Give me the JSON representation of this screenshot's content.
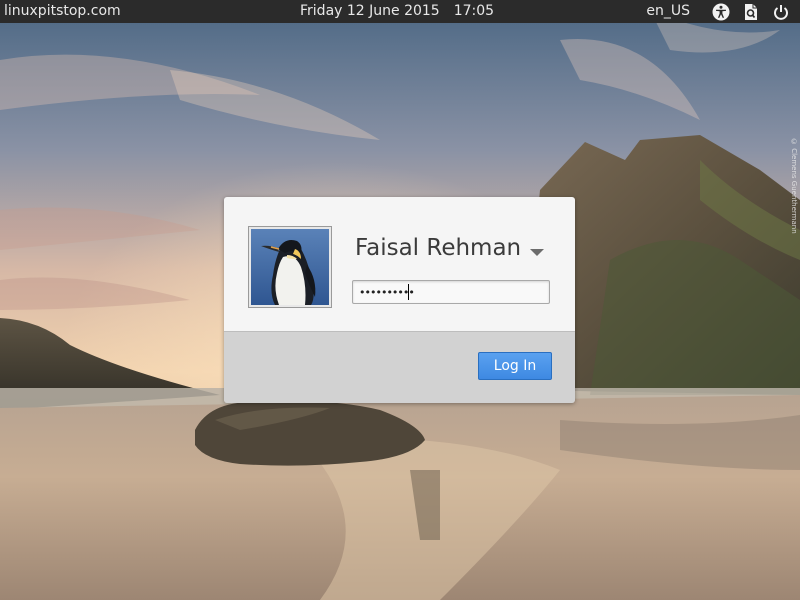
{
  "panel": {
    "hostname": "linuxpitstop.com",
    "date": "Friday 12 June 2015",
    "time": "17:05",
    "language": "en_US",
    "icons": [
      "accessibility-icon",
      "keyboard-layout-icon",
      "power-icon"
    ]
  },
  "photo_credit": "© Clemens Guenthermann",
  "login": {
    "user_name": "Faisal Rehman",
    "avatar": "penguin-avatar",
    "password_value": "••••••••••",
    "login_label": "Log In"
  },
  "colors": {
    "panel_bg": "#2b2b2b",
    "accent": "#3e89e2",
    "dialog_upper": "#f5f5f5",
    "dialog_lower": "#d2d2d2"
  }
}
